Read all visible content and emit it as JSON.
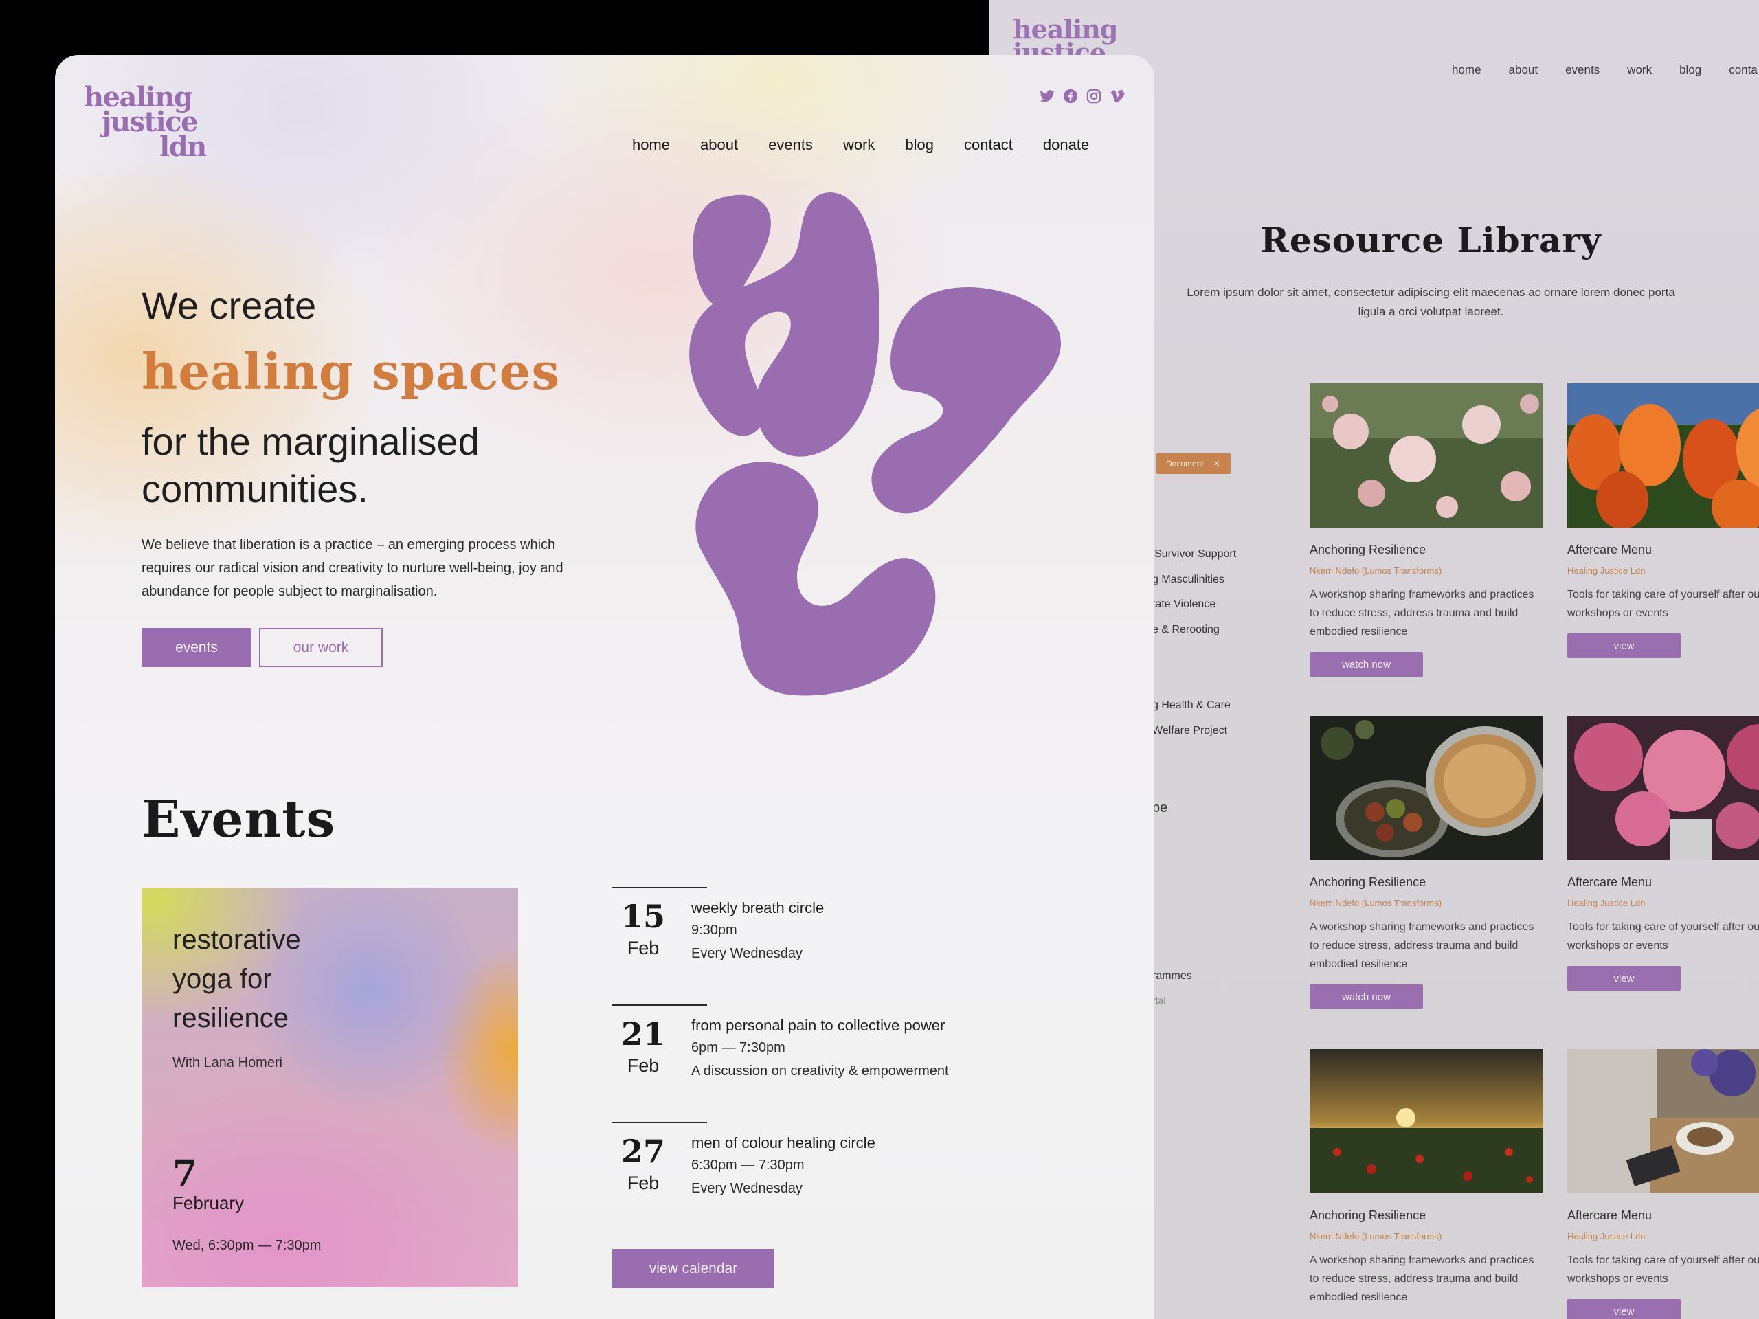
{
  "back_page": {
    "logo_text": "healing justice",
    "nav": [
      "home",
      "about",
      "events",
      "work",
      "blog",
      "conta"
    ],
    "title": "Resource Library",
    "lead": "Lorem ipsum dolor sit amet, consectetur adipiscing elit maecenas ac ornare lorem donec porta ligula a orci volutpat laoreet.",
    "filter_chip": "Document",
    "filter_items": [
      "e",
      "Survivor Support",
      "g Masculinities",
      "tate Violence",
      "e & Rerooting",
      "g Health & Care",
      "Welfare Project",
      "pe",
      "rammes",
      "rtal"
    ],
    "cards": [
      {
        "title": "Anchoring Resilience",
        "author": "Nkem Ndefo (Lumos Transforms)",
        "desc": "A workshop sharing frameworks and practices to reduce stress, address trauma and build embodied resilience",
        "button": "watch now",
        "thumb": "pink-roses"
      },
      {
        "title": "Aftercare Menu",
        "author": "Healing Justice Ldn",
        "desc": "Tools for taking care of yourself after our workshops or events",
        "button": "view",
        "thumb": "orange-tulips"
      },
      {
        "title": "Anchoring Resilience",
        "author": "Nkem Ndefo (Lumos Transforms)",
        "desc": "A workshop sharing frameworks and practices to reduce stress, address trauma and build embodied resilience",
        "button": "watch now",
        "thumb": "apples-pie"
      },
      {
        "title": "Aftercare Menu",
        "author": "Healing Justice Ldn",
        "desc": "Tools for taking care of yourself after our workshops or events",
        "button": "view",
        "thumb": "pink-peonies"
      },
      {
        "title": "Anchoring Resilience",
        "author": "Nkem Ndefo (Lumos Transforms)",
        "desc": "A workshop sharing frameworks and practices to reduce stress, address trauma and build embodied resilience",
        "button": "watch now",
        "thumb": "sunset-poppies"
      },
      {
        "title": "Aftercare Menu",
        "author": "Healing Justice Ldn",
        "desc": "Tools for taking care of yourself after our workshops or events",
        "button": "view",
        "thumb": "coffee-flowers"
      }
    ]
  },
  "front_page": {
    "logo": [
      "healing",
      "justice",
      "ldn"
    ],
    "socials": [
      "twitter-icon",
      "facebook-icon",
      "instagram-icon",
      "vimeo-icon"
    ],
    "nav": [
      "home",
      "about",
      "events",
      "work",
      "blog",
      "contact",
      "donate"
    ],
    "hero": {
      "line1": "We create",
      "accent": "healing spaces",
      "line3": "for the marginalised communities.",
      "body": "We believe that liberation is a practice – an emerging process which requires our radical vision and creativity to nurture well-being, joy and abundance for people subject to marginalisation.",
      "btn_events": "events",
      "btn_work": "our work"
    },
    "events": {
      "heading": "Events",
      "featured": {
        "title": "restorative yoga for resilience",
        "with": "With Lana Homeri",
        "day": "7",
        "month": "February",
        "time": "Wed, 6:30pm — 7:30pm"
      },
      "list": [
        {
          "day": "15",
          "month": "Feb",
          "title": "weekly breath circle",
          "time": "9:30pm",
          "note": "Every Wednesday"
        },
        {
          "day": "21",
          "month": "Feb",
          "title": "from personal pain to collective power",
          "time": "6pm — 7:30pm",
          "note": "A discussion on creativity & empowerment"
        },
        {
          "day": "27",
          "month": "Feb",
          "title": "men of colour healing circle",
          "time": "6:30pm — 7:30pm",
          "note": "Every Wednesday"
        }
      ],
      "calendar_button": "view calendar"
    }
  },
  "colors": {
    "purple": "#9a6db1",
    "orange": "#d27c3d",
    "ink": "#1f1f1f"
  }
}
